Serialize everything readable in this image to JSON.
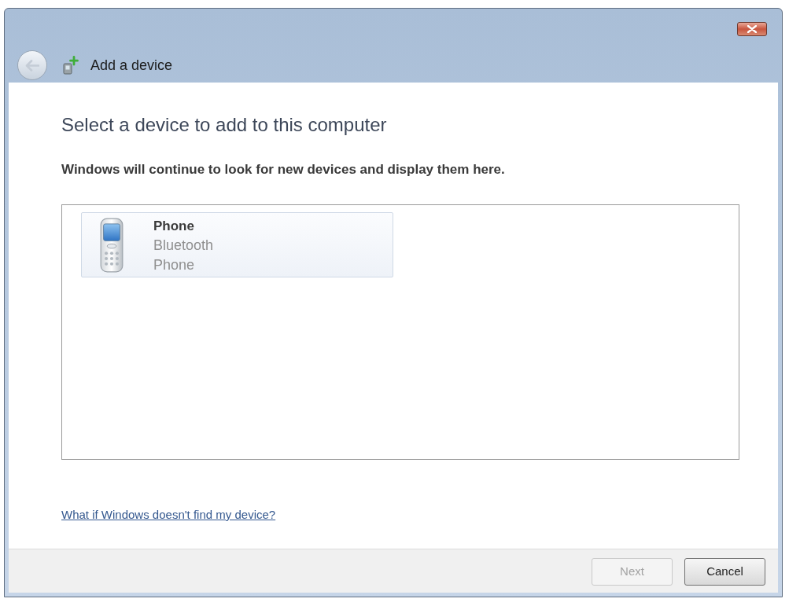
{
  "window": {
    "title": "Add a device"
  },
  "back_button": {
    "disabled": true
  },
  "heading": "Select a device to add to this computer",
  "instruction": "Windows will continue to look for new devices and display them here.",
  "devices": [
    {
      "name": "Phone",
      "details": [
        "Bluetooth",
        "Phone"
      ],
      "highlighted": true
    }
  ],
  "help_link": "What if Windows doesn't find my device?",
  "buttons": [
    {
      "label": "Next",
      "disabled": true
    },
    {
      "label": "Cancel",
      "disabled": false
    }
  ]
}
